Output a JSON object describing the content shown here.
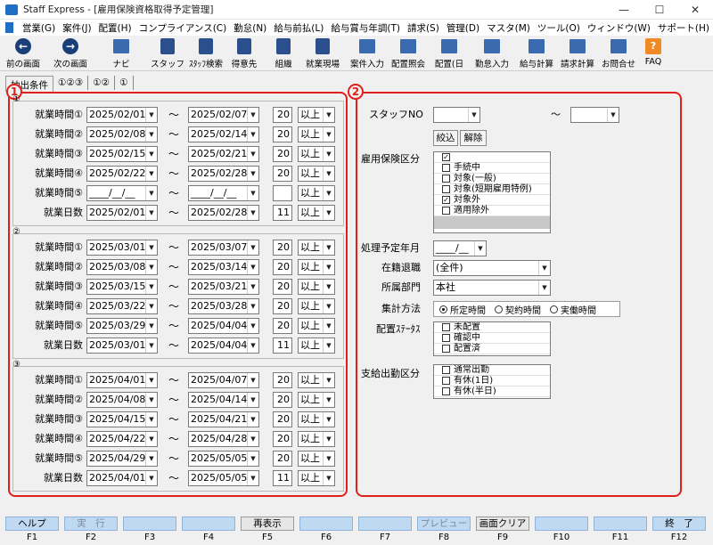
{
  "window": {
    "app": "Staff Express",
    "screen": "[雇用保険資格取得予定管理]",
    "title": "Staff Express - [雇用保険資格取得予定管理]",
    "controls": [
      "—",
      "☐",
      "✕"
    ]
  },
  "menu": [
    "営業(G)",
    "案件(J)",
    "配置(H)",
    "コンプライアンス(C)",
    "勤怠(N)",
    "給与前払(L)",
    "給与賞与年調(T)",
    "請求(S)",
    "管理(D)",
    "マスタ(M)",
    "ツール(O)",
    "ウィンドウ(W)",
    "サポート(H)"
  ],
  "toolbar": {
    "back": "前の画面",
    "next": "次の画面",
    "navi": "ナビ",
    "staff": "スタッフ",
    "staff_search": "ｽﾀｯﾌ検索",
    "client": "得意先",
    "org": "組織",
    "site": "就業現場",
    "job_input": "案件入力",
    "assign_ref": "配置照会",
    "assign": "配置(日",
    "attend_input": "勤怠入力",
    "payroll": "給与計算",
    "billing": "請求計算",
    "contact": "お問合せ",
    "faq": "FAQ"
  },
  "tabs": [
    "抽出条件",
    "①②③",
    "①②",
    "①"
  ],
  "marks": {
    "panel1": "1",
    "panel2": "2",
    "g1": "①",
    "g2": "②",
    "g3": "③"
  },
  "common": {
    "tilde": "～",
    "ijo": "以上",
    "dd": "▼"
  },
  "groups": [
    {
      "rows": [
        {
          "label": "就業時間①",
          "from": "2025/02/01",
          "to": "2025/02/07",
          "num": "20"
        },
        {
          "label": "就業時間②",
          "from": "2025/02/08",
          "to": "2025/02/14",
          "num": "20"
        },
        {
          "label": "就業時間③",
          "from": "2025/02/15",
          "to": "2025/02/21",
          "num": "20"
        },
        {
          "label": "就業時間④",
          "from": "2025/02/22",
          "to": "2025/02/28",
          "num": "20"
        },
        {
          "label": "就業時間⑤",
          "from": "____/__/__",
          "to": "____/__/__",
          "num": ""
        },
        {
          "label": "就業日数",
          "from": "2025/02/01",
          "to": "2025/02/28",
          "num": "11"
        }
      ]
    },
    {
      "rows": [
        {
          "label": "就業時間①",
          "from": "2025/03/01",
          "to": "2025/03/07",
          "num": "20"
        },
        {
          "label": "就業時間②",
          "from": "2025/03/08",
          "to": "2025/03/14",
          "num": "20"
        },
        {
          "label": "就業時間③",
          "from": "2025/03/15",
          "to": "2025/03/21",
          "num": "20"
        },
        {
          "label": "就業時間④",
          "from": "2025/03/22",
          "to": "2025/03/28",
          "num": "20"
        },
        {
          "label": "就業時間⑤",
          "from": "2025/03/29",
          "to": "2025/04/04",
          "num": "20"
        },
        {
          "label": "就業日数",
          "from": "2025/03/01",
          "to": "2025/04/04",
          "num": "11"
        }
      ]
    },
    {
      "rows": [
        {
          "label": "就業時間①",
          "from": "2025/04/01",
          "to": "2025/04/07",
          "num": "20"
        },
        {
          "label": "就業時間②",
          "from": "2025/04/08",
          "to": "2025/04/14",
          "num": "20"
        },
        {
          "label": "就業時間③",
          "from": "2025/04/15",
          "to": "2025/04/21",
          "num": "20"
        },
        {
          "label": "就業時間④",
          "from": "2025/04/22",
          "to": "2025/04/28",
          "num": "20"
        },
        {
          "label": "就業時間⑤",
          "from": "2025/04/29",
          "to": "2025/05/05",
          "num": "20"
        },
        {
          "label": "就業日数",
          "from": "2025/04/01",
          "to": "2025/05/05",
          "num": "11"
        }
      ]
    }
  ],
  "right": {
    "staff_no_label": "スタッフNO",
    "narrow": "絞込",
    "clear": "解除",
    "koyo_label": "雇用保険区分",
    "koyo_items": [
      {
        "text": "",
        "checked": true
      },
      {
        "text": "手続中",
        "checked": false
      },
      {
        "text": "対象(一般)",
        "checked": false
      },
      {
        "text": "対象(短期雇用特例)",
        "checked": false
      },
      {
        "text": "対象外",
        "checked": true
      },
      {
        "text": "適用除外",
        "checked": false
      }
    ],
    "shori_label": "処理予定年月",
    "shori_value": "____/__",
    "zaiseki_label": "在籍退職",
    "zaiseki_value": "(全件)",
    "busho_label": "所属部門",
    "busho_value": "本社",
    "shukei_label": "集計方法",
    "shukei_options": [
      {
        "text": "所定時間",
        "on": true
      },
      {
        "text": "契約時間",
        "on": false
      },
      {
        "text": "実働時間",
        "on": false
      }
    ],
    "haichi_label": "配置ｽﾃｰﾀｽ",
    "haichi_items": [
      {
        "text": "未配置",
        "checked": false
      },
      {
        "text": "確認中",
        "checked": false
      },
      {
        "text": "配置済",
        "checked": false
      }
    ],
    "shikyu_label": "支給出勤区分",
    "shikyu_items": [
      {
        "text": "通常出勤",
        "checked": false
      },
      {
        "text": "有休(1日)",
        "checked": false
      },
      {
        "text": "有休(半日)",
        "checked": false
      }
    ]
  },
  "fkeys": [
    {
      "key": "F1",
      "label": "ヘルプ",
      "state": "on"
    },
    {
      "key": "F2",
      "label": "実　行",
      "state": "dis"
    },
    {
      "key": "F3",
      "label": "",
      "state": "on"
    },
    {
      "key": "F4",
      "label": "",
      "state": "on"
    },
    {
      "key": "F5",
      "label": "再表示",
      "state": "light"
    },
    {
      "key": "F6",
      "label": "",
      "state": "on"
    },
    {
      "key": "F7",
      "label": "",
      "state": "on"
    },
    {
      "key": "F8",
      "label": "プレビュー",
      "state": "dis"
    },
    {
      "key": "F9",
      "label": "画面クリア",
      "state": "light"
    },
    {
      "key": "F10",
      "label": "",
      "state": "on"
    },
    {
      "key": "F11",
      "label": "",
      "state": "on"
    },
    {
      "key": "F12",
      "label": "終　了",
      "state": "on"
    }
  ]
}
